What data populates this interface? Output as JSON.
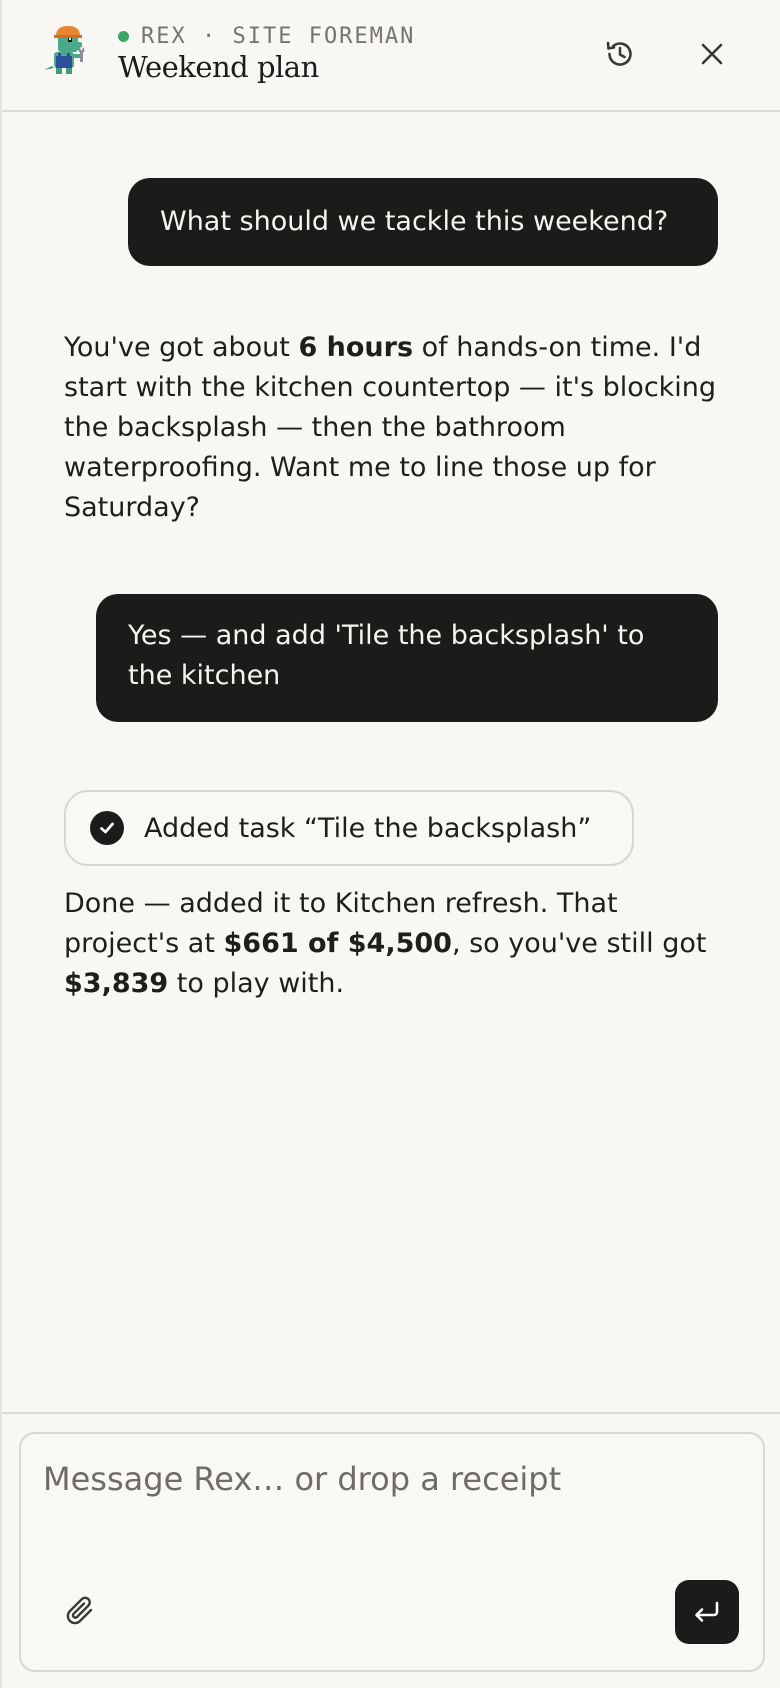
{
  "header": {
    "eyebrow": "REX · SITE FOREMAN",
    "title": "Weekend plan",
    "status_color": "#3fa565",
    "history_icon": "history-icon",
    "close_icon": "close-icon"
  },
  "messages": [
    {
      "role": "user",
      "text": "What should we tackle this weekend?"
    },
    {
      "role": "assistant",
      "parts": [
        "You've got about ",
        "6 hours",
        " of hands-on time. I'd start with the kitchen countertop — it's blocking the backsplash — then the bathroom waterproofing. Want me to line those up for Saturday?"
      ]
    },
    {
      "role": "user",
      "text": "Yes — and add 'Tile the backsplash' to the kitchen"
    },
    {
      "role": "tool",
      "text": "Added task “Tile the backsplash”"
    },
    {
      "role": "assistant",
      "parts": [
        "Done — added it to Kitchen refresh. That project's at ",
        "$661 of $4,500",
        ", so you've still got ",
        "$3,839",
        " to play with."
      ]
    }
  ],
  "composer": {
    "placeholder": "Message Rex… or drop a receipt",
    "value": "",
    "attach_icon": "paperclip-icon",
    "send_icon": "enter-icon"
  },
  "colors": {
    "background": "#f9f7f3",
    "bubble": "#1c1b1a",
    "accent_green": "#3fa565"
  }
}
